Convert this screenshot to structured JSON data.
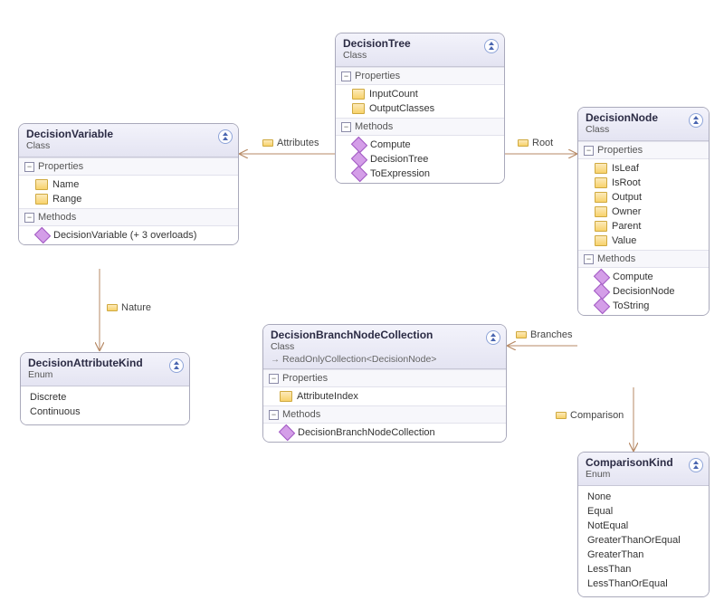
{
  "labels": {
    "class": "Class",
    "enum": "Enum",
    "properties": "Properties",
    "methods": "Methods"
  },
  "edges": {
    "attributes": "Attributes",
    "root": "Root",
    "nature": "Nature",
    "branches": "Branches",
    "comparison": "Comparison"
  },
  "decisionTree": {
    "title": "DecisionTree",
    "properties": [
      "InputCount",
      "OutputClasses"
    ],
    "methods": [
      "Compute",
      "DecisionTree",
      "ToExpression"
    ]
  },
  "decisionVariable": {
    "title": "DecisionVariable",
    "properties": [
      "Name",
      "Range"
    ],
    "methods": [
      "DecisionVariable (+ 3 overloads)"
    ]
  },
  "decisionNode": {
    "title": "DecisionNode",
    "properties": [
      "IsLeaf",
      "IsRoot",
      "Output",
      "Owner",
      "Parent",
      "Value"
    ],
    "methods": [
      "Compute",
      "DecisionNode",
      "ToString"
    ]
  },
  "decisionBranch": {
    "title": "DecisionBranchNodeCollection",
    "inherits": "ReadOnlyCollection<DecisionNode>",
    "properties": [
      "AttributeIndex"
    ],
    "methods": [
      "DecisionBranchNodeCollection"
    ]
  },
  "decisionAttrKind": {
    "title": "DecisionAttributeKind",
    "values": [
      "Discrete",
      "Continuous"
    ]
  },
  "comparisonKind": {
    "title": "ComparisonKind",
    "values": [
      "None",
      "Equal",
      "NotEqual",
      "GreaterThanOrEqual",
      "GreaterThan",
      "LessThan",
      "LessThanOrEqual"
    ]
  }
}
